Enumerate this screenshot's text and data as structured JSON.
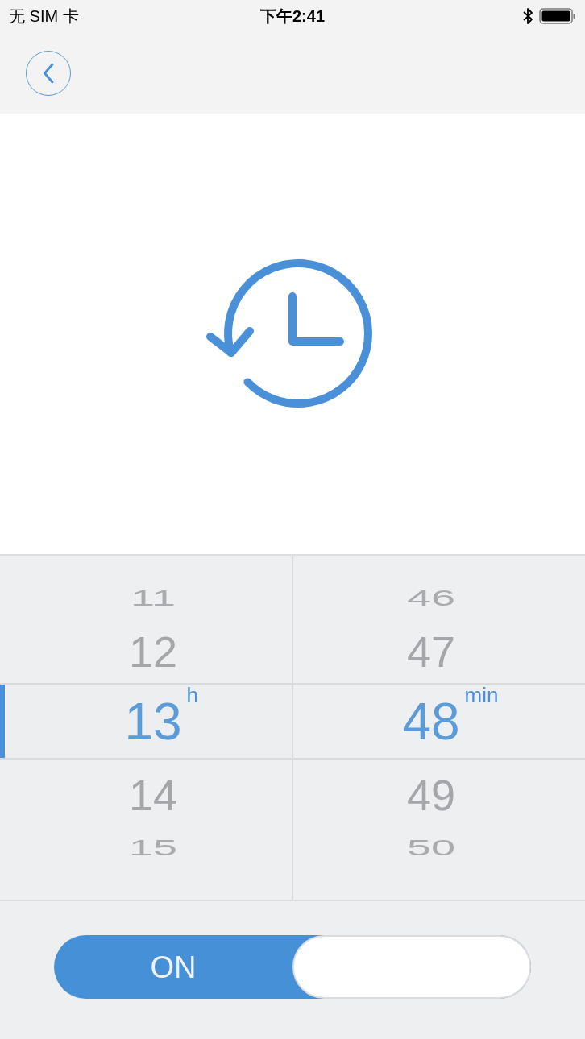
{
  "status_bar": {
    "carrier": "无 SIM 卡",
    "time": "下午2:41"
  },
  "picker": {
    "columns": [
      {
        "unit": "h",
        "focused": true,
        "items": [
          {
            "label": "11",
            "selected": false
          },
          {
            "label": "12",
            "selected": false
          },
          {
            "label": "13",
            "selected": true
          },
          {
            "label": "14",
            "selected": false
          },
          {
            "label": "15",
            "selected": false
          }
        ]
      },
      {
        "unit": "min",
        "focused": false,
        "items": [
          {
            "label": "46",
            "selected": false
          },
          {
            "label": "47",
            "selected": false
          },
          {
            "label": "48",
            "selected": true
          },
          {
            "label": "49",
            "selected": false
          },
          {
            "label": "50",
            "selected": false
          }
        ]
      }
    ]
  },
  "toggle": {
    "label": "ON",
    "on": true
  }
}
